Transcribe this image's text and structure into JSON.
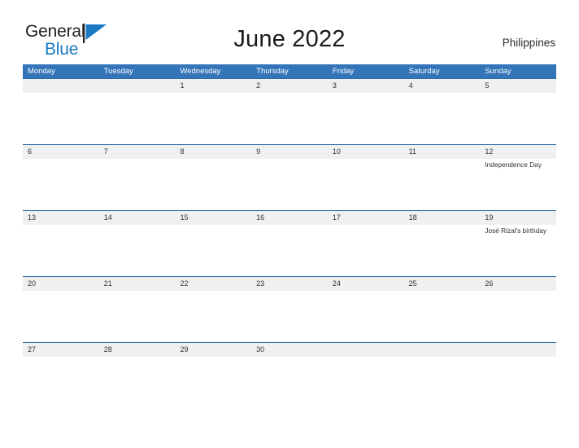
{
  "brand": {
    "word_one": "General",
    "word_two": "Blue",
    "flag_icon": "blue-triangle-flag-icon",
    "color_dark": "#231f20",
    "color_blue": "#1a7ac4"
  },
  "header": {
    "title": "June 2022",
    "country": "Philippines"
  },
  "theme": {
    "header_blue": "#3375b8",
    "row_border_blue": "#2e6da4",
    "date_band_gray": "#f0f0f0",
    "text_color": "#333333"
  },
  "calendar": {
    "weekdays": [
      "Monday",
      "Tuesday",
      "Wednesday",
      "Thursday",
      "Friday",
      "Saturday",
      "Sunday"
    ],
    "weeks": [
      [
        {
          "day": ""
        },
        {
          "day": ""
        },
        {
          "day": "1"
        },
        {
          "day": "2"
        },
        {
          "day": "3"
        },
        {
          "day": "4"
        },
        {
          "day": "5"
        }
      ],
      [
        {
          "day": "6"
        },
        {
          "day": "7"
        },
        {
          "day": "8"
        },
        {
          "day": "9"
        },
        {
          "day": "10"
        },
        {
          "day": "11"
        },
        {
          "day": "12",
          "event": "Independence Day"
        }
      ],
      [
        {
          "day": "13"
        },
        {
          "day": "14"
        },
        {
          "day": "15"
        },
        {
          "day": "16"
        },
        {
          "day": "17"
        },
        {
          "day": "18"
        },
        {
          "day": "19",
          "event": "José Rizal's birthday"
        }
      ],
      [
        {
          "day": "20"
        },
        {
          "day": "21"
        },
        {
          "day": "22"
        },
        {
          "day": "23"
        },
        {
          "day": "24"
        },
        {
          "day": "25"
        },
        {
          "day": "26"
        }
      ],
      [
        {
          "day": "27"
        },
        {
          "day": "28"
        },
        {
          "day": "29"
        },
        {
          "day": "30"
        },
        {
          "day": ""
        },
        {
          "day": ""
        },
        {
          "day": ""
        }
      ]
    ]
  }
}
